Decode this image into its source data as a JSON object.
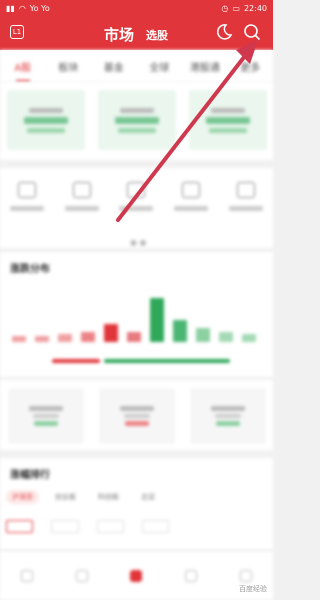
{
  "status_bar": {
    "left": "Yo Yo",
    "time": "22:40"
  },
  "header": {
    "left_icon": "L1",
    "title": "市场",
    "subtitle": "选股"
  },
  "tabs": [
    "A股",
    "板块",
    "基金",
    "全球",
    "港股通",
    "更多"
  ],
  "colors": {
    "brand_red": "#e0353a",
    "green": "#2fa85a",
    "arrow": "#d0384e"
  },
  "section_distribution": {
    "title": "涨跌分布"
  },
  "section_rank": {
    "title": "涨幅排行",
    "tabs": [
      "沪深京",
      "创业板",
      "科创板",
      "北证"
    ]
  },
  "watermark": "百度经验"
}
